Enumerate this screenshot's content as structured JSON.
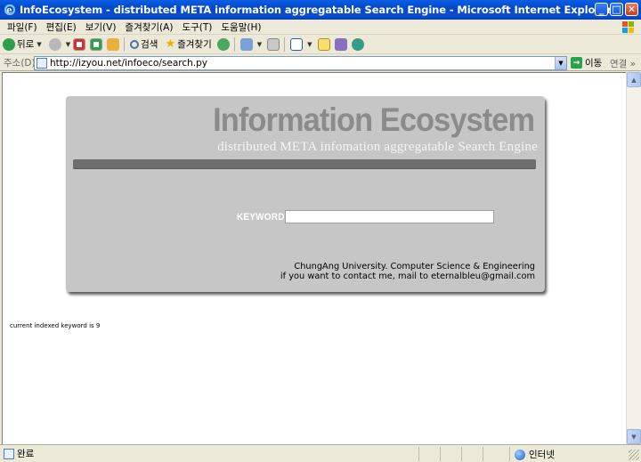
{
  "window": {
    "title": "InfoEcosystem - distributed META information aggregatable Search Engine - Microsoft Internet Explorer",
    "min_label": "_",
    "max_label": "□",
    "close_label": "✕"
  },
  "menu": {
    "items": [
      "파일(F)",
      "편집(E)",
      "보기(V)",
      "즐겨찾기(A)",
      "도구(T)",
      "도움말(H)"
    ]
  },
  "toolbar": {
    "back_label": "뒤로",
    "search_label": "검색",
    "favorites_label": "즐겨찾기"
  },
  "address": {
    "label": "주소(D)",
    "url": "http://izyou.net/infoeco/search.py",
    "go_label": "이동",
    "links_label": "연결 »"
  },
  "page": {
    "brand_title": "Information Ecosystem",
    "brand_subtitle": "distributed META infomation aggregatable Search Engine",
    "keyword_label": "KEYWORD :",
    "keyword_value": "",
    "affiliation": "ChungAng University. Computer Science & Engineering",
    "contact": "if you want to contact me, mail to eternalbleu@gmail.com",
    "indexed_text": "current indexed keyword is 9"
  },
  "status": {
    "text": "완료",
    "zone": "인터넷"
  },
  "colors": {
    "titlebar": "#0348c8",
    "panel": "#c6c6c6",
    "brand_title": "#8b8b8b",
    "divider": "#6e6e6e"
  }
}
